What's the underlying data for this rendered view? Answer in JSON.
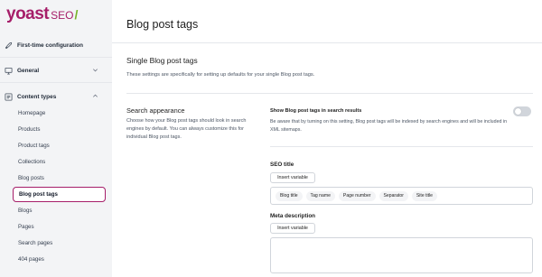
{
  "logo": {
    "brand": "yoast",
    "product": "SEO",
    "slash": "/"
  },
  "sidebar": {
    "first_time": "First-time configuration",
    "general": "General",
    "content_types": "Content types",
    "items": [
      {
        "label": "Homepage"
      },
      {
        "label": "Products"
      },
      {
        "label": "Product tags"
      },
      {
        "label": "Collections"
      },
      {
        "label": "Blog posts"
      },
      {
        "label": "Blog post tags"
      },
      {
        "label": "Blogs"
      },
      {
        "label": "Pages"
      },
      {
        "label": "Search pages"
      },
      {
        "label": "404 pages"
      }
    ],
    "active_index": 5
  },
  "main": {
    "page_title": "Blog post tags",
    "section_title": "Single Blog post tags",
    "section_desc": "These settings are specifically for setting up defaults for your single Blog post tags.",
    "search_appearance": {
      "title": "Search appearance",
      "desc": "Choose how your Blog post tags should look in search engines by default. You can always customize this for individual Blog post tags."
    },
    "toggle": {
      "label": "Show Blog post tags in search results",
      "desc": "Be aware that by turning on this setting, Blog post tags will be indexed by search engines and will be included in XML sitemaps.",
      "on": false
    },
    "seo_title": {
      "label": "SEO title",
      "insert": "Insert variable",
      "variables": [
        "Blog title",
        "Tag name",
        "Page number",
        "Separator",
        "Site title"
      ]
    },
    "meta_description": {
      "label": "Meta description",
      "insert": "Insert variable"
    }
  },
  "colors": {
    "brand": "#a61e69",
    "accent_green": "#77b227"
  }
}
